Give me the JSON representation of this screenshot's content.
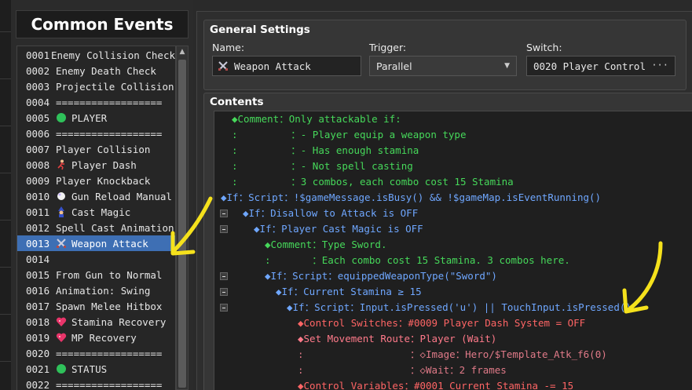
{
  "sidebar": {
    "title": "Common Events",
    "items": [
      {
        "num": "0001",
        "label": "Enemy Collision Check",
        "icon": ""
      },
      {
        "num": "0002",
        "label": "Enemy Death Check",
        "icon": ""
      },
      {
        "num": "0003",
        "label": "Projectile Collision",
        "icon": ""
      },
      {
        "num": "0004",
        "label": "==================",
        "icon": ""
      },
      {
        "num": "0005",
        "label": "PLAYER",
        "icon": "green-circle-icon"
      },
      {
        "num": "0006",
        "label": "==================",
        "icon": ""
      },
      {
        "num": "0007",
        "label": "Player Collision",
        "icon": ""
      },
      {
        "num": "0008",
        "label": "Player Dash",
        "icon": "running-figure-icon"
      },
      {
        "num": "0009",
        "label": "Player Knockback",
        "icon": ""
      },
      {
        "num": "0010",
        "label": "Gun Reload Manual",
        "icon": "white-circle-icon"
      },
      {
        "num": "0011",
        "label": "Cast Magic",
        "icon": "mage-icon"
      },
      {
        "num": "0012",
        "label": "Spell Cast Animation",
        "icon": ""
      },
      {
        "num": "0013",
        "label": "Weapon Attack",
        "icon": "crossed-swords-icon",
        "selected": true
      },
      {
        "num": "0014",
        "label": "",
        "icon": ""
      },
      {
        "num": "0015",
        "label": "From Gun to Normal",
        "icon": ""
      },
      {
        "num": "0016",
        "label": "Animation: Swing",
        "icon": ""
      },
      {
        "num": "0017",
        "label": "Spawn Melee Hitbox",
        "icon": ""
      },
      {
        "num": "0018",
        "label": "Stamina Recovery",
        "icon": "heart-icon"
      },
      {
        "num": "0019",
        "label": "MP Recovery",
        "icon": "heart-icon"
      },
      {
        "num": "0020",
        "label": "==================",
        "icon": ""
      },
      {
        "num": "0021",
        "label": "STATUS",
        "icon": "green-circle-icon"
      },
      {
        "num": "0022",
        "label": "==================",
        "icon": ""
      }
    ]
  },
  "general": {
    "title": "General Settings",
    "name_label": "Name:",
    "name_value": "Weapon Attack",
    "trigger_label": "Trigger:",
    "trigger_value": "Parallel",
    "switch_label": "Switch:",
    "switch_value": "0020 Player Control",
    "switch_button": "···"
  },
  "contents": {
    "title": "Contents",
    "lines": [
      {
        "text": "◆Comment：Only attackable if:",
        "color": "comment",
        "indent": 0
      },
      {
        "text": ":         ：- Player equip a weapon type",
        "color": "comment",
        "indent": 0
      },
      {
        "text": ":         ：- Has enough stamina",
        "color": "comment",
        "indent": 0
      },
      {
        "text": ":         ：- Not spell casting",
        "color": "comment",
        "indent": 0
      },
      {
        "text": ":         ：3 combos, each combo cost 15 Stamina",
        "color": "comment",
        "indent": 0
      },
      {
        "text": "◆If：Script：!$gameMessage.isBusy() && !$gameMap.isEventRunning()",
        "color": "cond",
        "indent": -1
      },
      {
        "text": "◆If：Disallow to Attack is OFF",
        "color": "cond",
        "indent": 1,
        "fold": true
      },
      {
        "text": "◆If：Player Cast Magic is OFF",
        "color": "cond",
        "indent": 2,
        "fold": true
      },
      {
        "text": "◆Comment：Type Sword.",
        "color": "comment",
        "indent": 3
      },
      {
        "text": ":       ：Each combo cost 15 Stamina. 3 combos here.",
        "color": "comment",
        "indent": 3
      },
      {
        "text": "◆If：Script：equippedWeaponType(\"Sword\")",
        "color": "cond",
        "indent": 3,
        "fold": true
      },
      {
        "text": "◆If：Current Stamina ≥ 15",
        "color": "cond",
        "indent": 4,
        "fold": true
      },
      {
        "text": "◆If：Script：Input.isPressed('u') || TouchInput.isPressed()",
        "color": "cond",
        "indent": 5,
        "fold": true
      },
      {
        "text": "◆Control Switches：#0009 Player Dash System = OFF",
        "color": "switch",
        "indent": 6
      },
      {
        "text": "◆Set Movement Route：Player (Wait)",
        "color": "route",
        "indent": 6
      },
      {
        "text": ":                  ：◇Image：Hero/$Template_Atk_f6(0)",
        "color": "image",
        "indent": 6
      },
      {
        "text": ":                  ：◇Wait：2 frames",
        "color": "image",
        "indent": 6
      },
      {
        "text": "◆Control Variables：#0001 Current Stamina -= 15",
        "color": "switch",
        "indent": 6
      }
    ]
  },
  "colors": {
    "selected_row": "#3e6fb4",
    "comment": "#46d85a",
    "condition": "#6fa7ff",
    "switch": "#ff6565",
    "annotation_arrow": "#f5e11c"
  }
}
